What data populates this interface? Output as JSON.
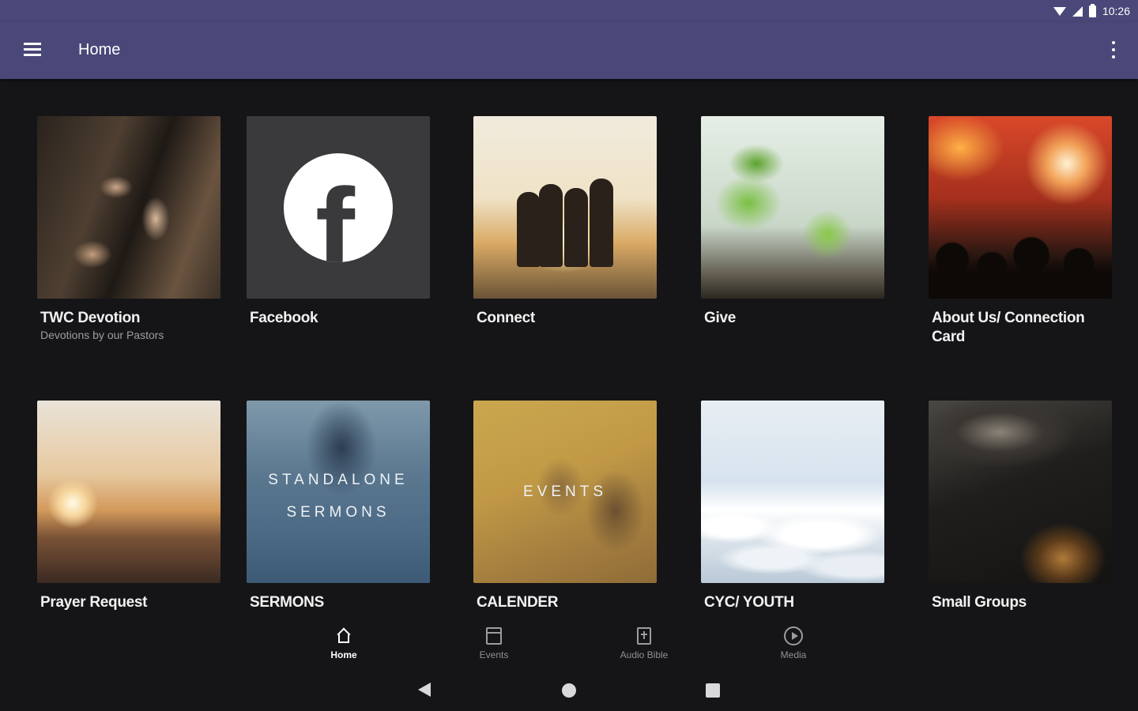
{
  "status_bar": {
    "time": "10:26"
  },
  "app_bar": {
    "title": "Home"
  },
  "tiles": [
    {
      "title": "TWC Devotion",
      "subtitle": "Devotions by our Pastors"
    },
    {
      "title": "Facebook",
      "icon": "facebook-icon"
    },
    {
      "title": "Connect"
    },
    {
      "title": "Give"
    },
    {
      "title": "About Us/ Connection Card"
    },
    {
      "title": "Prayer Request"
    },
    {
      "title": "SERMONS",
      "overlay_line1": "STANDALONE",
      "overlay_line2": "SERMONS"
    },
    {
      "title": "CALENDER",
      "overlay_line1": "EVENTS"
    },
    {
      "title": "CYC/ YOUTH"
    },
    {
      "title": "Small Groups"
    }
  ],
  "bottom_nav": [
    {
      "label": "Home",
      "icon": "home-icon",
      "active": true
    },
    {
      "label": "Events",
      "icon": "calendar-icon"
    },
    {
      "label": "Audio Bible",
      "icon": "bible-icon"
    },
    {
      "label": "Media",
      "icon": "play-icon"
    }
  ]
}
